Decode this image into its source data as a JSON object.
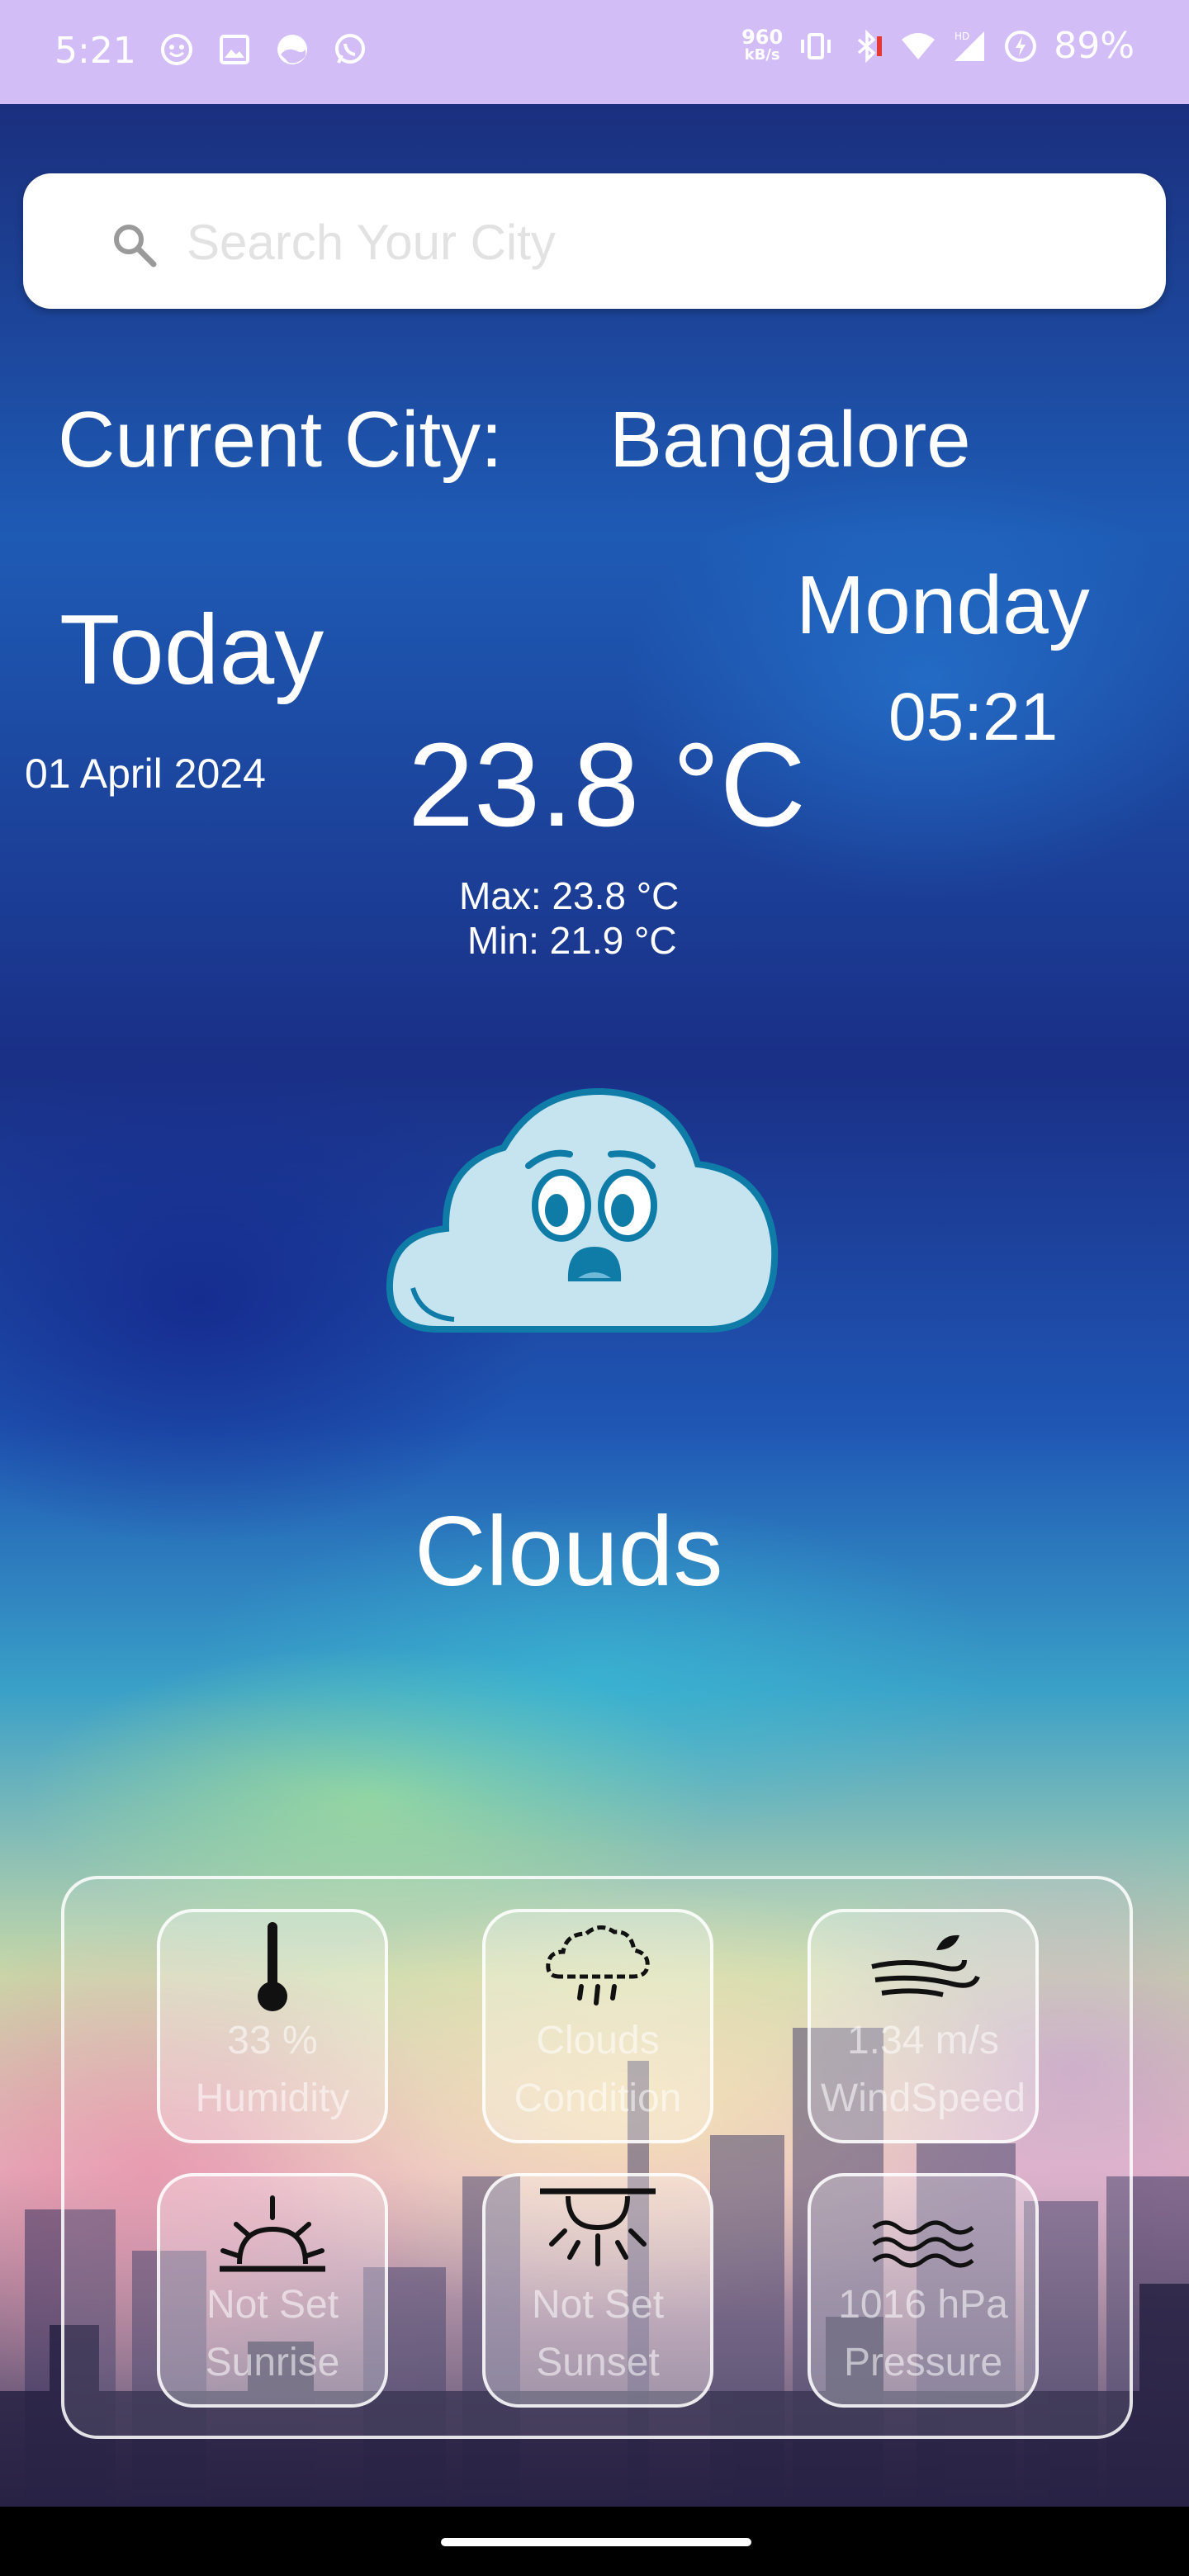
{
  "status_bar": {
    "time": "5:21",
    "net_speed_value": "960",
    "net_speed_unit": "kB/s",
    "battery": "89%"
  },
  "search": {
    "placeholder": "Search Your City",
    "icon": "search-icon"
  },
  "location": {
    "label": "Current City:",
    "city": "Bangalore"
  },
  "datetime": {
    "heading": "Today",
    "date": "01 April 2024",
    "day": "Monday",
    "time": "05:21"
  },
  "weather": {
    "temperature": "23.8 °C",
    "max": "Max: 23.8 °C",
    "min": "Min: 21.9 °C",
    "condition": "Clouds",
    "icon": "worried-cloud-icon"
  },
  "details": [
    {
      "value": "33 %",
      "label": "Humidity",
      "icon": "thermometer-icon"
    },
    {
      "value": "Clouds",
      "label": "Condition",
      "icon": "rain-cloud-icon"
    },
    {
      "value": "1.34 m/s",
      "label": "WindSpeed",
      "icon": "wind-icon"
    },
    {
      "value": "Not Set",
      "label": "Sunrise",
      "icon": "sunrise-icon"
    },
    {
      "value": "Not Set",
      "label": "Sunset",
      "icon": "sunset-icon"
    },
    {
      "value": "1016 hPa",
      "label": "Pressure",
      "icon": "waves-icon"
    }
  ],
  "colors": {
    "status_bar": "#d2bdf6",
    "text": "#ffffff",
    "cloud_fill": "#c5e4f0",
    "cloud_outline": "#0f7ca8"
  }
}
